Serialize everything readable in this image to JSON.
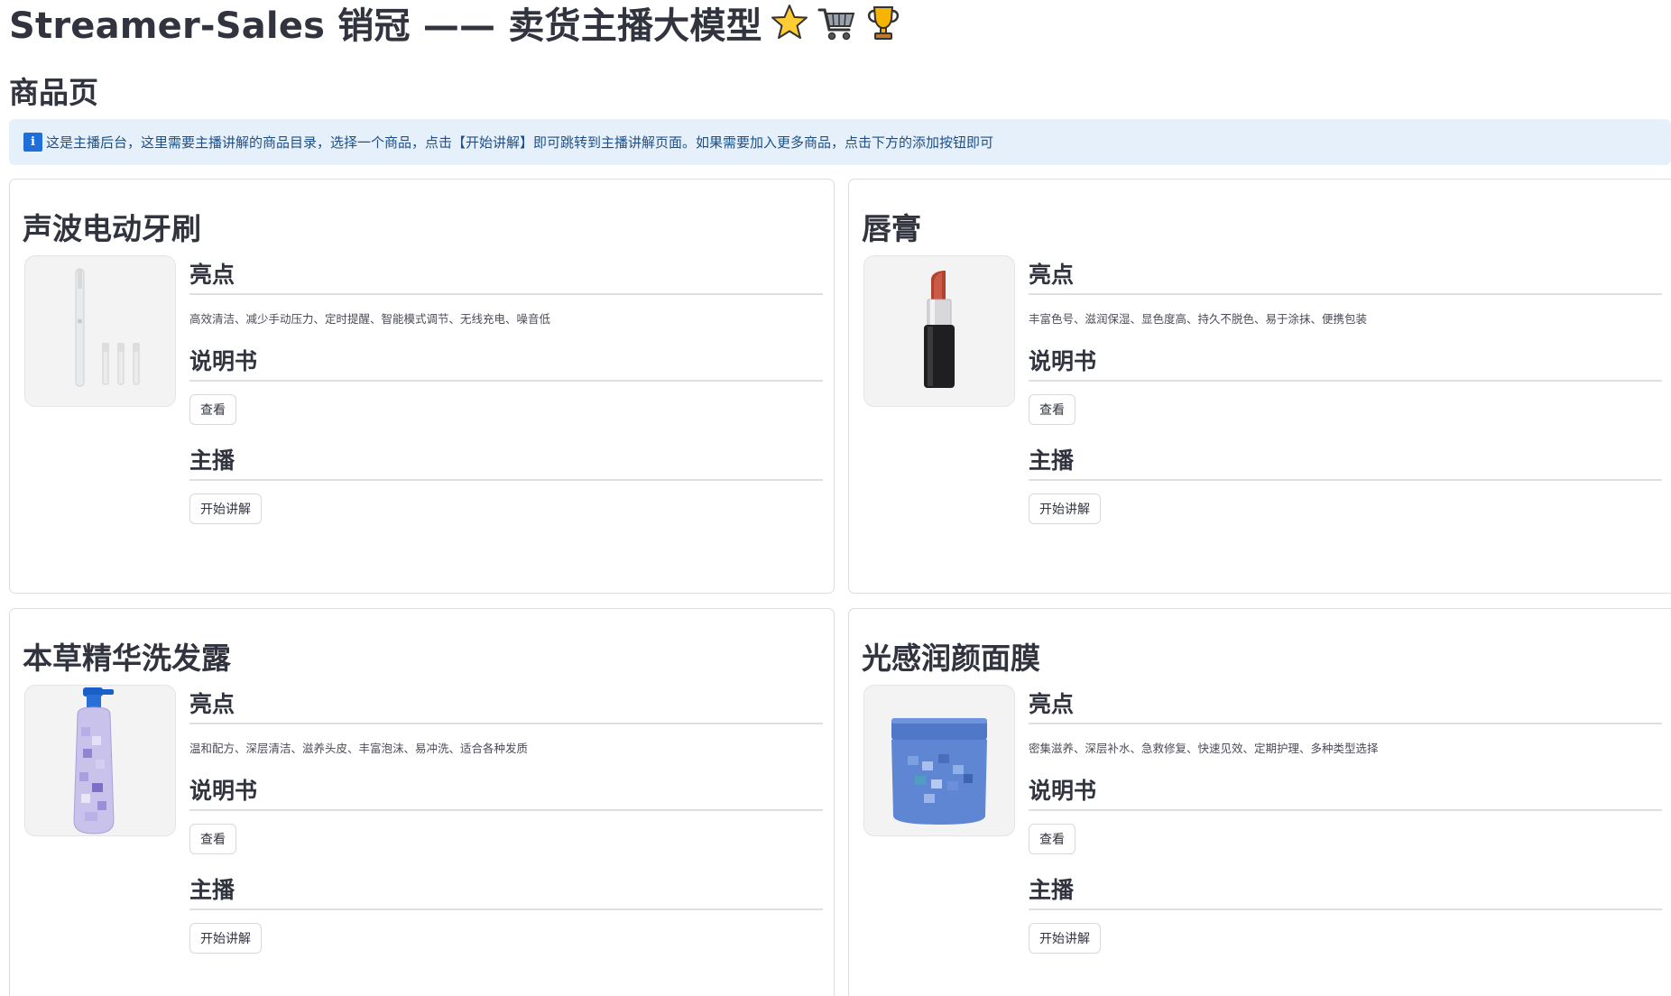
{
  "app": {
    "title": "Streamer-Sales 销冠 —— 卖货主播大模型"
  },
  "page": {
    "title": "商品页"
  },
  "info": {
    "message": "这是主播后台，这里需要主播讲解的商品目录，选择一个商品，点击【开始讲解】即可跳转到主播讲解页面。如果需要加入更多商品，点击下方的添加按钮即可"
  },
  "labels": {
    "highlights": "亮点",
    "manual": "说明书",
    "streamer": "主播",
    "view": "查看",
    "start": "开始讲解"
  },
  "products": [
    {
      "name": "声波电动牙刷",
      "highlights": "高效清洁、减少手动压力、定时提醒、智能模式调节、无线充电、噪音低"
    },
    {
      "name": "唇膏",
      "highlights": "丰富色号、滋润保湿、显色度高、持久不脱色、易于涂抹、便携包装"
    },
    {
      "name": "本草精华洗发露",
      "highlights": "温和配方、深层清洁、滋养头皮、丰富泡沫、易冲洗、适合各种发质"
    },
    {
      "name": "光感润颜面膜",
      "highlights": "密集滋养、深层补水、急救修复、快速见效、定期护理、多种类型选择"
    }
  ],
  "icons": {
    "title_emojis": [
      "star-icon",
      "shopping-cart-icon",
      "trophy-icon"
    ],
    "info": "info-icon"
  },
  "colors": {
    "info_bg": "#e6f0fb",
    "info_text": "#1c4f8a",
    "info_icon": "#1e6fd9"
  }
}
